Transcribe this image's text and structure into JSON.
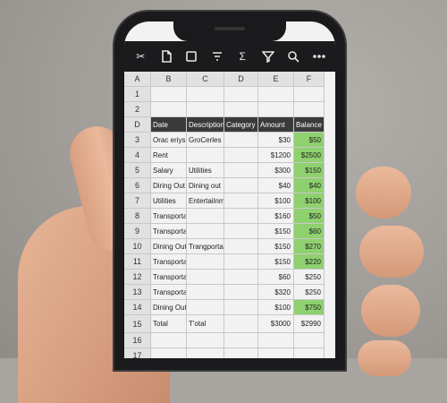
{
  "toolbar": {
    "icons": [
      "scissors-icon",
      "document-icon",
      "square-icon",
      "filter-lines-icon",
      "sum-icon",
      "funnel-icon",
      "search-icon",
      "more-icon"
    ],
    "glyphs": [
      "✂",
      "",
      "",
      "",
      "Σ",
      "",
      "",
      ""
    ]
  },
  "columns": [
    "A",
    "B",
    "C",
    "D",
    "E",
    "F"
  ],
  "headers": {
    "date": "Date",
    "description": "Description",
    "category": "Category",
    "amount": "Amount",
    "balance": "Balance"
  },
  "rows": [
    {
      "n": "1",
      "b": "",
      "c": "",
      "d": "",
      "e": "",
      "f": ""
    },
    {
      "n": "2",
      "b": "",
      "c": "",
      "d": "",
      "e": "",
      "f": ""
    },
    {
      "n": "D",
      "header": true
    },
    {
      "n": "3",
      "b": "Orac eriys",
      "c": "GroCerles",
      "d": "",
      "e": "$30",
      "f": "$50",
      "green": true
    },
    {
      "n": "4",
      "b": "Rent",
      "c": "",
      "d": "",
      "e": "$1200",
      "f": "$2500",
      "green": true
    },
    {
      "n": "5",
      "b": "Salary",
      "c": "Utilities",
      "d": "",
      "e": "$300",
      "f": "$150",
      "green": true
    },
    {
      "n": "6",
      "b": "Diring Out",
      "c": "Dining out",
      "d": "",
      "e": "$40",
      "f": "$40",
      "green": true
    },
    {
      "n": "7",
      "b": "Utilities",
      "c": "Entertailnment",
      "d": "",
      "e": "$100",
      "f": "$100",
      "green": true
    },
    {
      "n": "8",
      "b": "Transportation",
      "c": "",
      "d": "",
      "e": "$160",
      "f": "$50",
      "green": true
    },
    {
      "n": "9",
      "b": "Transportation",
      "c": "",
      "d": "",
      "e": "$150",
      "f": "$60",
      "green": true
    },
    {
      "n": "10",
      "b": "Dining Out",
      "c": "Trangportation",
      "d": "",
      "e": "$150",
      "f": "$270",
      "green": true
    },
    {
      "n": "11",
      "b": "Transportat",
      "c": "",
      "d": "",
      "e": "$150",
      "f": "$220",
      "green": true
    },
    {
      "n": "12",
      "b": "Transportation",
      "c": "",
      "d": "",
      "e": "$60",
      "f": "$250",
      "green": false
    },
    {
      "n": "13",
      "b": "Transportation",
      "c": "",
      "d": "",
      "e": "$320",
      "f": "$250",
      "green": false
    },
    {
      "n": "14",
      "b": "Dining Out",
      "c": "",
      "d": "",
      "e": "$100",
      "f": "$750",
      "green": true
    },
    {
      "n": "15",
      "b": "Total",
      "c": "T'otal",
      "d": "",
      "e": "$3000",
      "f": "$2990",
      "green": false,
      "total": true
    },
    {
      "n": "16",
      "b": "",
      "c": "",
      "d": "",
      "e": "",
      "f": ""
    },
    {
      "n": "17",
      "b": "",
      "c": "",
      "d": "",
      "e": "",
      "f": ""
    }
  ]
}
